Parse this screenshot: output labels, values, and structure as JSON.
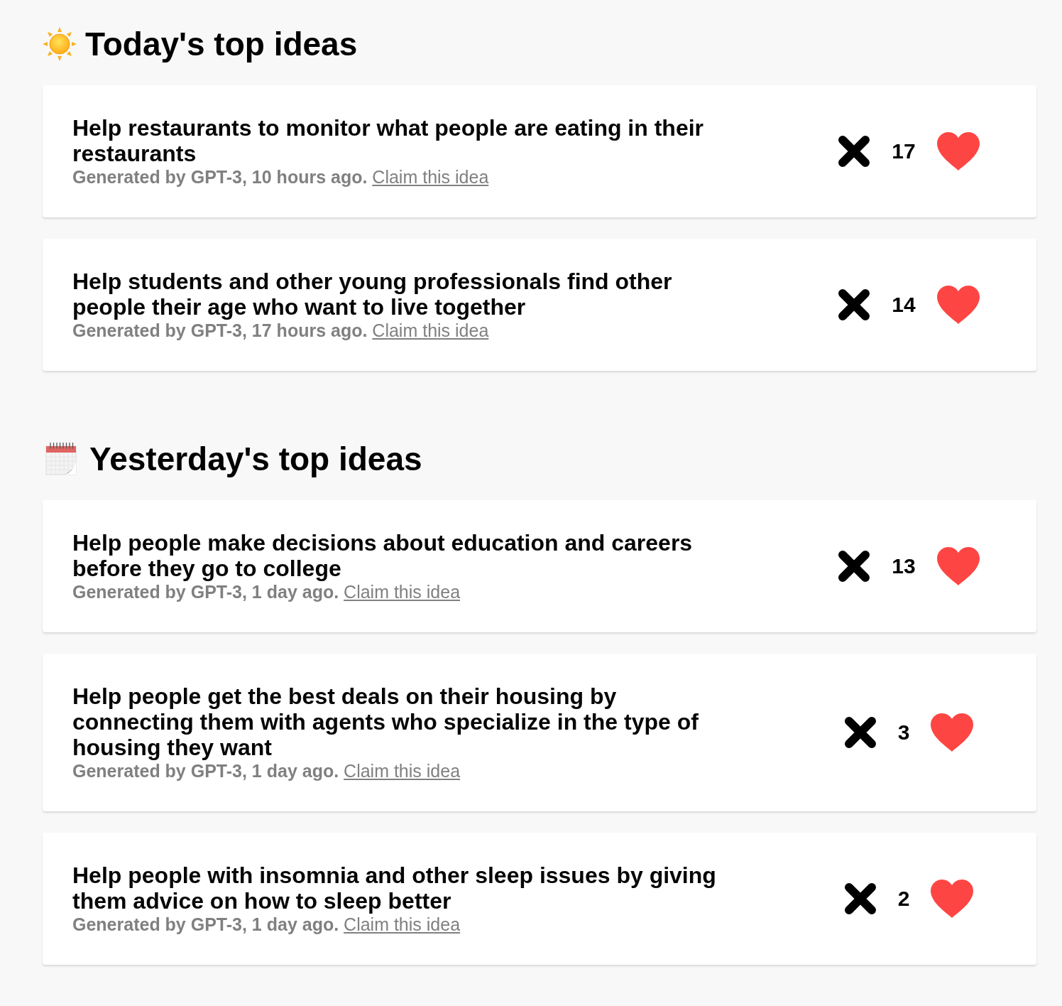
{
  "sections": [
    {
      "kind": "sun",
      "title": "Today's top ideas",
      "ideas": [
        {
          "title": "Help restaurants to monitor what people are eating in their restaurants",
          "meta": "Generated by GPT-3, 10 hours ago.",
          "link": "Claim this idea",
          "votes": "17"
        },
        {
          "title": "Help students and other young professionals find other people their age who want to live together",
          "meta": "Generated by GPT-3, 17 hours ago.",
          "link": "Claim this idea",
          "votes": "14"
        }
      ]
    },
    {
      "kind": "calendar",
      "title": "Yesterday's top ideas",
      "ideas": [
        {
          "title": "Help people make decisions about education and careers before they go to college",
          "meta": "Generated by GPT-3, 1 day ago.",
          "link": "Claim this idea",
          "votes": "13"
        },
        {
          "title": "Help people get the best deals on their housing by connecting them with agents who specialize in the type of housing they want",
          "meta": "Generated by GPT-3, 1 day ago.",
          "link": "Claim this idea",
          "votes": "3"
        },
        {
          "title": "Help people with insomnia and other sleep issues by giving them advice on how to sleep better",
          "meta": "Generated by GPT-3, 1 day ago.",
          "link": "Claim this idea",
          "votes": "2"
        }
      ]
    }
  ]
}
